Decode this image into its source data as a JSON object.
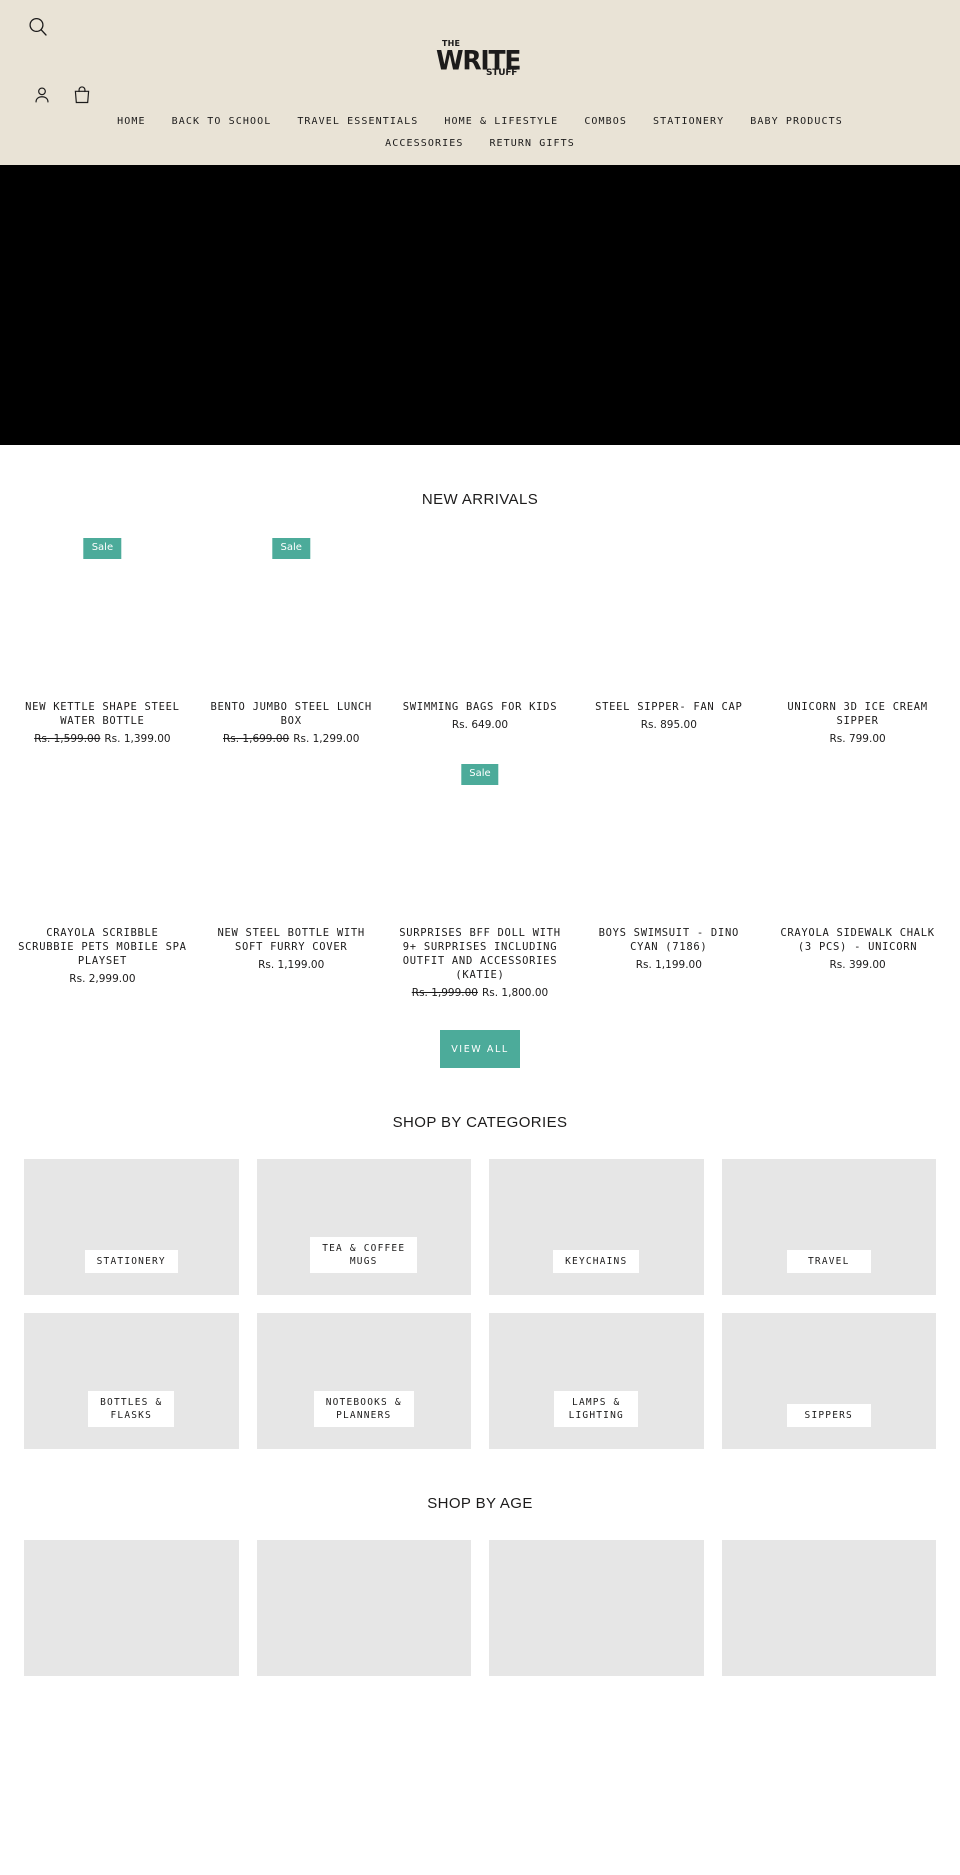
{
  "theme": {
    "header_bg": "#e9e3d6",
    "accent": "#4cab9a",
    "hero_bg": "#000000",
    "tile_bg": "#e6e6e6",
    "text": "#1c1b1b"
  },
  "header": {
    "logo": {
      "line1": "THE",
      "line2": "WRITE",
      "line3": "STUFF"
    },
    "nav_row1": [
      {
        "label": "HOME"
      },
      {
        "label": "BACK TO SCHOOL"
      },
      {
        "label": "TRAVEL ESSENTIALS"
      },
      {
        "label": "HOME & LIFESTYLE"
      },
      {
        "label": "COMBOS"
      },
      {
        "label": "STATIONERY"
      },
      {
        "label": "BABY PRODUCTS"
      }
    ],
    "nav_row2": [
      {
        "label": "ACCESSORIES"
      },
      {
        "label": "RETURN GIFTS"
      }
    ]
  },
  "new_arrivals": {
    "title": "NEW ARRIVALS",
    "view_all_label": "VIEW\nALL",
    "sale_badge": "Sale",
    "products": [
      {
        "title": "NEW KETTLE SHAPE STEEL WATER BOTTLE",
        "price_old": "Rs. 1,599.00",
        "price_new": "Rs. 1,399.00",
        "on_sale": true
      },
      {
        "title": "BENTO JUMBO STEEL LUNCH BOX",
        "price_old": "Rs. 1,699.00",
        "price_new": "Rs. 1,299.00",
        "on_sale": true
      },
      {
        "title": "SWIMMING BAGS FOR KIDS",
        "price_old": "",
        "price_new": "Rs. 649.00",
        "on_sale": false
      },
      {
        "title": "STEEL SIPPER- FAN CAP",
        "price_old": "",
        "price_new": "Rs. 895.00",
        "on_sale": false
      },
      {
        "title": "UNICORN 3D ICE CREAM SIPPER",
        "price_old": "",
        "price_new": "Rs. 799.00",
        "on_sale": false
      },
      {
        "title": "CRAYOLA SCRIBBLE SCRUBBIE PETS MOBILE SPA PLAYSET",
        "price_old": "",
        "price_new": "Rs. 2,999.00",
        "on_sale": false
      },
      {
        "title": "NEW STEEL BOTTLE WITH SOFT FURRY COVER",
        "price_old": "",
        "price_new": "Rs. 1,199.00",
        "on_sale": false
      },
      {
        "title": "SURPRISES BFF DOLL WITH 9+ SURPRISES INCLUDING OUTFIT AND ACCESSORIES (KATIE)",
        "price_old": "Rs. 1,999.00",
        "price_new": "Rs. 1,800.00",
        "on_sale": true
      },
      {
        "title": "BOYS SWIMSUIT - DINO CYAN (7186)",
        "price_old": "",
        "price_new": "Rs. 1,199.00",
        "on_sale": false
      },
      {
        "title": "CRAYOLA SIDEWALK CHALK (3 PCS) - UNICORN",
        "price_old": "",
        "price_new": "Rs. 399.00",
        "on_sale": false
      }
    ]
  },
  "categories": {
    "title": "SHOP BY CATEGORIES",
    "items": [
      {
        "label": "STATIONERY"
      },
      {
        "label": "TEA & COFFEE\nMUGS"
      },
      {
        "label": "KEYCHAINS"
      },
      {
        "label": "TRAVEL"
      },
      {
        "label": "BOTTLES &\nFLASKS"
      },
      {
        "label": "NOTEBOOKS &\nPLANNERS"
      },
      {
        "label": "LAMPS &\nLIGHTING"
      },
      {
        "label": "SIPPERS"
      }
    ]
  },
  "ages": {
    "title": "SHOP BY AGE",
    "items": [
      {
        "label": ""
      },
      {
        "label": ""
      },
      {
        "label": ""
      },
      {
        "label": ""
      }
    ]
  }
}
